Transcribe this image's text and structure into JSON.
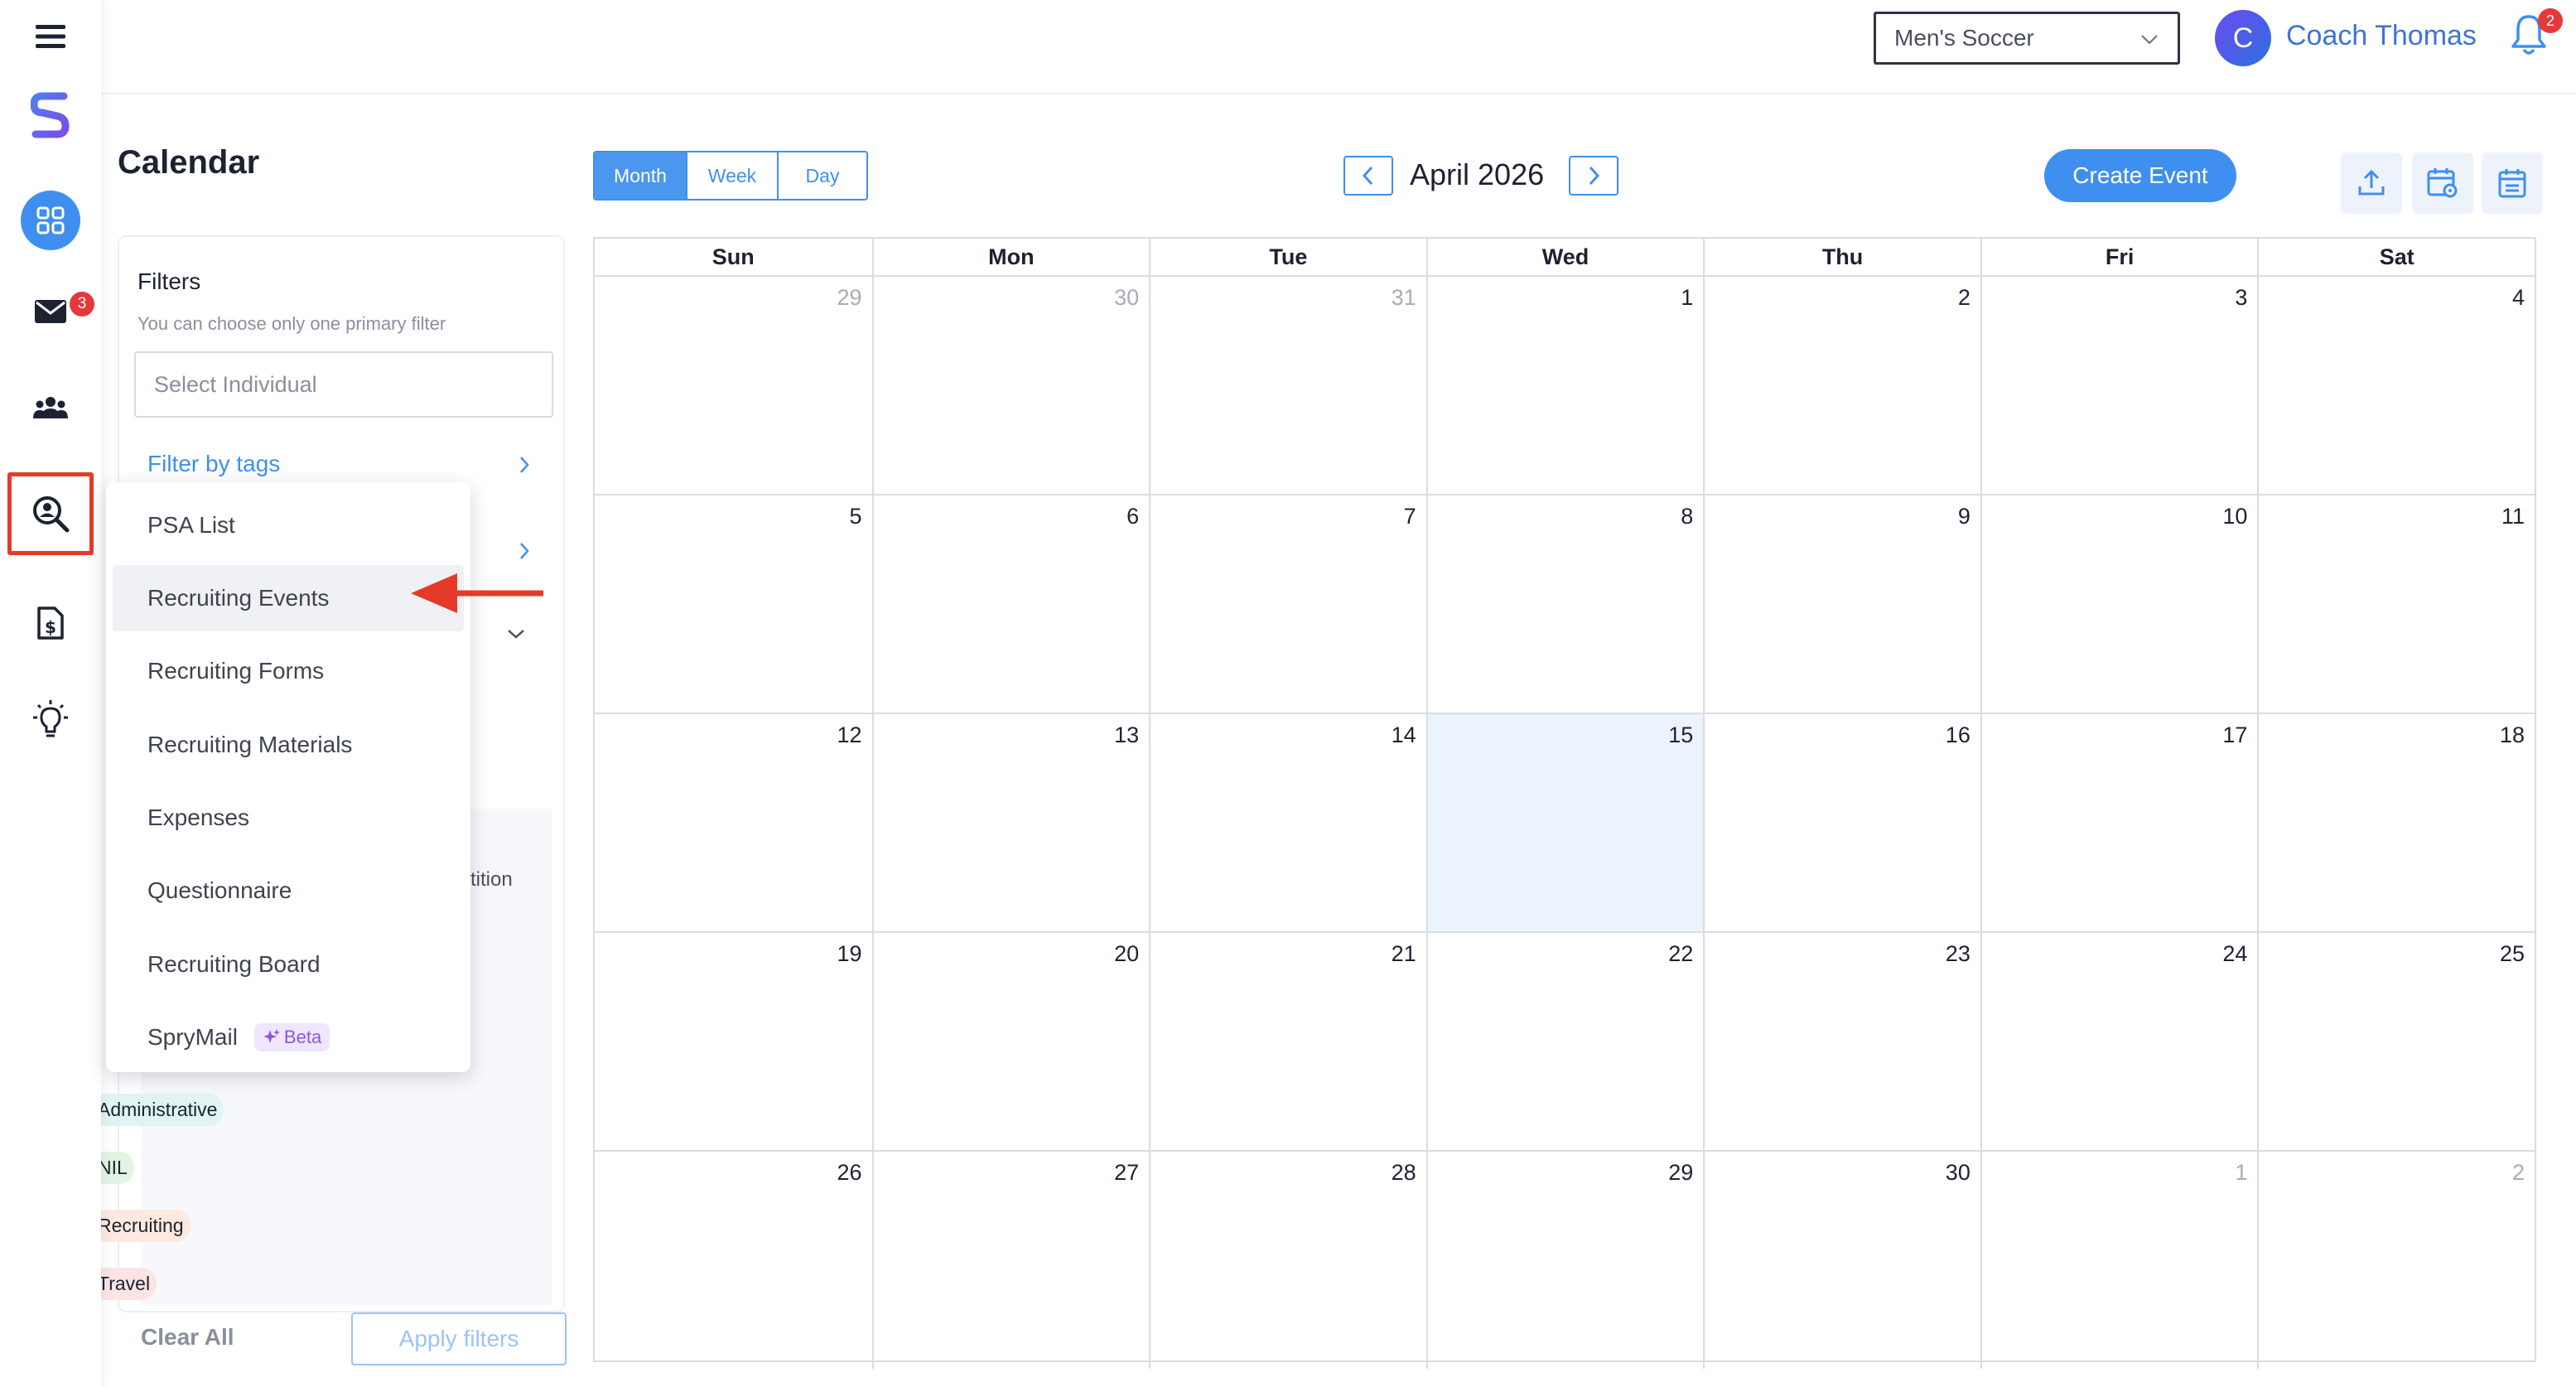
{
  "rail": {
    "mail_badge": "3"
  },
  "topbar": {
    "team": "Men's Soccer",
    "avatar_initial": "C",
    "user_name": "Coach Thomas",
    "notification_count": "2"
  },
  "page": {
    "title": "Calendar"
  },
  "views": {
    "month": "Month",
    "week": "Week",
    "day": "Day",
    "active": "Month"
  },
  "calendar": {
    "month_label": "April 2026",
    "create_event": "Create Event",
    "weekdays": [
      "Sun",
      "Mon",
      "Tue",
      "Wed",
      "Thu",
      "Fri",
      "Sat"
    ],
    "today": "15",
    "weeks": [
      [
        "29",
        "30",
        "31",
        "1",
        "2",
        "3",
        "4"
      ],
      [
        "5",
        "6",
        "7",
        "8",
        "9",
        "10",
        "11"
      ],
      [
        "12",
        "13",
        "14",
        "15",
        "16",
        "17",
        "18"
      ],
      [
        "19",
        "20",
        "21",
        "22",
        "23",
        "24",
        "25"
      ],
      [
        "26",
        "27",
        "28",
        "29",
        "30",
        "1",
        "2"
      ]
    ]
  },
  "filters": {
    "title": "Filters",
    "hint": "You can choose only one primary filter",
    "individual_placeholder": "Select Individual",
    "by_tags": "Filter by tags",
    "partial_text": "tition",
    "categories": [
      {
        "label": "Administrative",
        "color": "#dff4f3"
      },
      {
        "label": "NIL",
        "color": "#e3f4e2"
      },
      {
        "label": "Recruiting",
        "color": "#fde9df"
      },
      {
        "label": "Travel",
        "color": "#fde4e4"
      }
    ],
    "clear_all": "Clear All",
    "apply": "Apply filters"
  },
  "menu": {
    "items": [
      "PSA List",
      "Recruiting Events",
      "Recruiting Forms",
      "Recruiting Materials",
      "Expenses",
      "Questionnaire",
      "Recruiting Board",
      "SpryMail"
    ],
    "highlighted": "Recruiting Events",
    "beta_label": "Beta"
  },
  "colors": {
    "accent": "#3f8ff0",
    "highlight_box": "#e53a2a",
    "today_bg": "#ebf4fd"
  }
}
